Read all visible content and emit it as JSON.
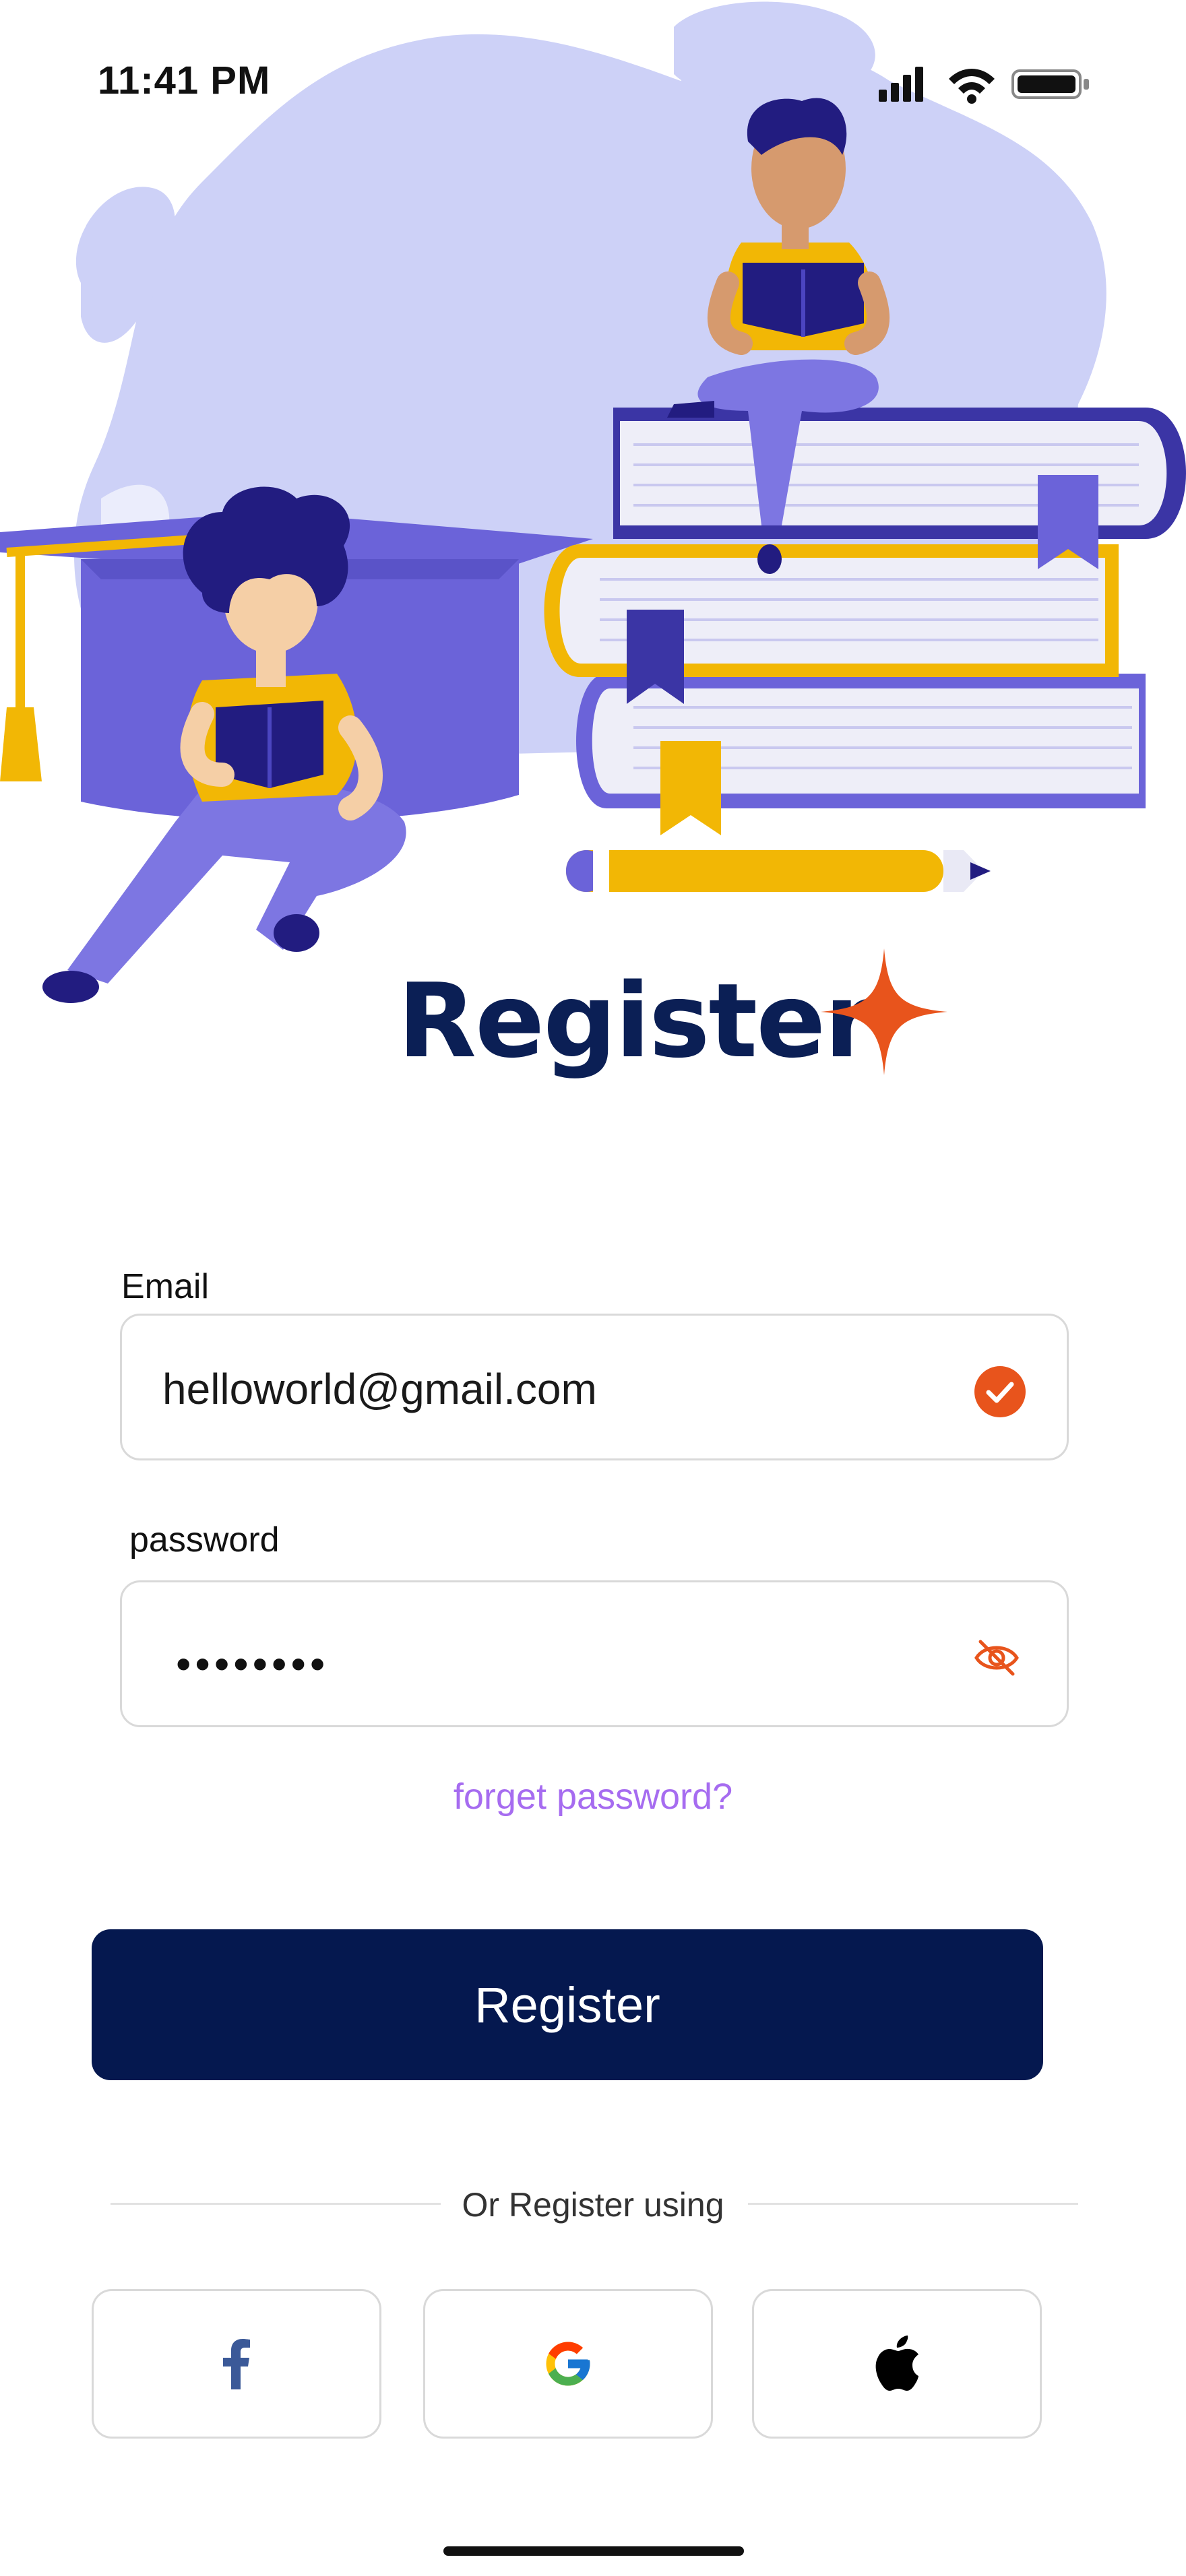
{
  "status_bar": {
    "time": "11:41 PM",
    "icons": [
      "signal-icon",
      "wifi-icon",
      "battery-icon"
    ]
  },
  "hero": {
    "illustration": "students-reading-books-with-graduation-cap"
  },
  "title": {
    "text": "Register",
    "accent_icon": "sparkle-icon",
    "accent_color": "#e8541c"
  },
  "form": {
    "email": {
      "label": "Email",
      "value": "helloworld@gmail.com",
      "status_icon": "check-circle-icon"
    },
    "password": {
      "label": "password",
      "masked_value": "••••••••",
      "toggle_icon": "eye-off-icon"
    },
    "forgot_link": "forget password?"
  },
  "primary_button": {
    "label": "Register"
  },
  "divider": {
    "text": "Or Register using"
  },
  "social": [
    {
      "name": "facebook",
      "icon": "facebook-icon"
    },
    {
      "name": "google",
      "icon": "google-icon"
    },
    {
      "name": "apple",
      "icon": "apple-icon"
    }
  ],
  "colors": {
    "brand_navy": "#05184f",
    "title_navy": "#0b1f55",
    "accent_orange": "#e8541c",
    "link_purple": "#a66cf0",
    "illustration_purple": "#6b63d9",
    "illustration_lavender": "#cdd1f7",
    "illustration_yellow": "#f2b705"
  }
}
